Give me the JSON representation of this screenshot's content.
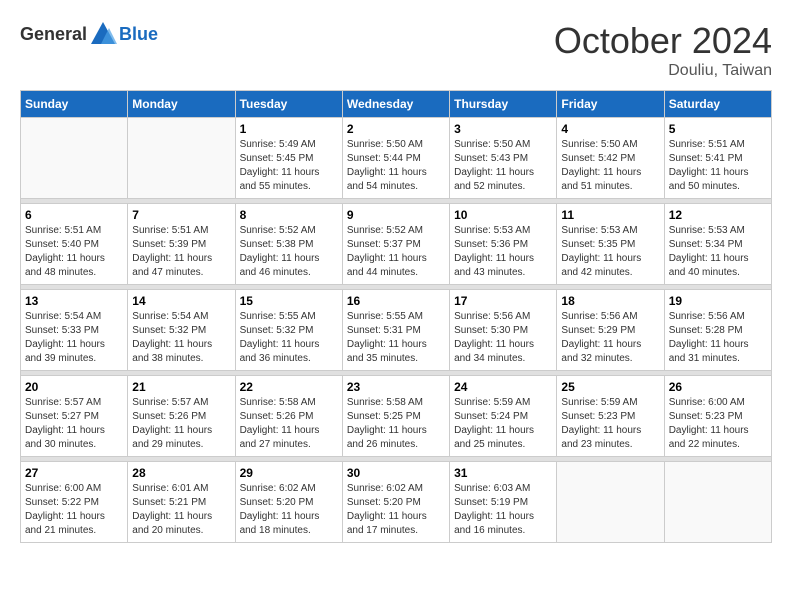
{
  "header": {
    "logo_general": "General",
    "logo_blue": "Blue",
    "month_title": "October 2024",
    "subtitle": "Douliu, Taiwan"
  },
  "weekdays": [
    "Sunday",
    "Monday",
    "Tuesday",
    "Wednesday",
    "Thursday",
    "Friday",
    "Saturday"
  ],
  "weeks": [
    [
      {
        "day": "",
        "info": ""
      },
      {
        "day": "",
        "info": ""
      },
      {
        "day": "1",
        "info": "Sunrise: 5:49 AM\nSunset: 5:45 PM\nDaylight: 11 hours and 55 minutes."
      },
      {
        "day": "2",
        "info": "Sunrise: 5:50 AM\nSunset: 5:44 PM\nDaylight: 11 hours and 54 minutes."
      },
      {
        "day": "3",
        "info": "Sunrise: 5:50 AM\nSunset: 5:43 PM\nDaylight: 11 hours and 52 minutes."
      },
      {
        "day": "4",
        "info": "Sunrise: 5:50 AM\nSunset: 5:42 PM\nDaylight: 11 hours and 51 minutes."
      },
      {
        "day": "5",
        "info": "Sunrise: 5:51 AM\nSunset: 5:41 PM\nDaylight: 11 hours and 50 minutes."
      }
    ],
    [
      {
        "day": "6",
        "info": "Sunrise: 5:51 AM\nSunset: 5:40 PM\nDaylight: 11 hours and 48 minutes."
      },
      {
        "day": "7",
        "info": "Sunrise: 5:51 AM\nSunset: 5:39 PM\nDaylight: 11 hours and 47 minutes."
      },
      {
        "day": "8",
        "info": "Sunrise: 5:52 AM\nSunset: 5:38 PM\nDaylight: 11 hours and 46 minutes."
      },
      {
        "day": "9",
        "info": "Sunrise: 5:52 AM\nSunset: 5:37 PM\nDaylight: 11 hours and 44 minutes."
      },
      {
        "day": "10",
        "info": "Sunrise: 5:53 AM\nSunset: 5:36 PM\nDaylight: 11 hours and 43 minutes."
      },
      {
        "day": "11",
        "info": "Sunrise: 5:53 AM\nSunset: 5:35 PM\nDaylight: 11 hours and 42 minutes."
      },
      {
        "day": "12",
        "info": "Sunrise: 5:53 AM\nSunset: 5:34 PM\nDaylight: 11 hours and 40 minutes."
      }
    ],
    [
      {
        "day": "13",
        "info": "Sunrise: 5:54 AM\nSunset: 5:33 PM\nDaylight: 11 hours and 39 minutes."
      },
      {
        "day": "14",
        "info": "Sunrise: 5:54 AM\nSunset: 5:32 PM\nDaylight: 11 hours and 38 minutes."
      },
      {
        "day": "15",
        "info": "Sunrise: 5:55 AM\nSunset: 5:32 PM\nDaylight: 11 hours and 36 minutes."
      },
      {
        "day": "16",
        "info": "Sunrise: 5:55 AM\nSunset: 5:31 PM\nDaylight: 11 hours and 35 minutes."
      },
      {
        "day": "17",
        "info": "Sunrise: 5:56 AM\nSunset: 5:30 PM\nDaylight: 11 hours and 34 minutes."
      },
      {
        "day": "18",
        "info": "Sunrise: 5:56 AM\nSunset: 5:29 PM\nDaylight: 11 hours and 32 minutes."
      },
      {
        "day": "19",
        "info": "Sunrise: 5:56 AM\nSunset: 5:28 PM\nDaylight: 11 hours and 31 minutes."
      }
    ],
    [
      {
        "day": "20",
        "info": "Sunrise: 5:57 AM\nSunset: 5:27 PM\nDaylight: 11 hours and 30 minutes."
      },
      {
        "day": "21",
        "info": "Sunrise: 5:57 AM\nSunset: 5:26 PM\nDaylight: 11 hours and 29 minutes."
      },
      {
        "day": "22",
        "info": "Sunrise: 5:58 AM\nSunset: 5:26 PM\nDaylight: 11 hours and 27 minutes."
      },
      {
        "day": "23",
        "info": "Sunrise: 5:58 AM\nSunset: 5:25 PM\nDaylight: 11 hours and 26 minutes."
      },
      {
        "day": "24",
        "info": "Sunrise: 5:59 AM\nSunset: 5:24 PM\nDaylight: 11 hours and 25 minutes."
      },
      {
        "day": "25",
        "info": "Sunrise: 5:59 AM\nSunset: 5:23 PM\nDaylight: 11 hours and 23 minutes."
      },
      {
        "day": "26",
        "info": "Sunrise: 6:00 AM\nSunset: 5:23 PM\nDaylight: 11 hours and 22 minutes."
      }
    ],
    [
      {
        "day": "27",
        "info": "Sunrise: 6:00 AM\nSunset: 5:22 PM\nDaylight: 11 hours and 21 minutes."
      },
      {
        "day": "28",
        "info": "Sunrise: 6:01 AM\nSunset: 5:21 PM\nDaylight: 11 hours and 20 minutes."
      },
      {
        "day": "29",
        "info": "Sunrise: 6:02 AM\nSunset: 5:20 PM\nDaylight: 11 hours and 18 minutes."
      },
      {
        "day": "30",
        "info": "Sunrise: 6:02 AM\nSunset: 5:20 PM\nDaylight: 11 hours and 17 minutes."
      },
      {
        "day": "31",
        "info": "Sunrise: 6:03 AM\nSunset: 5:19 PM\nDaylight: 11 hours and 16 minutes."
      },
      {
        "day": "",
        "info": ""
      },
      {
        "day": "",
        "info": ""
      }
    ]
  ]
}
